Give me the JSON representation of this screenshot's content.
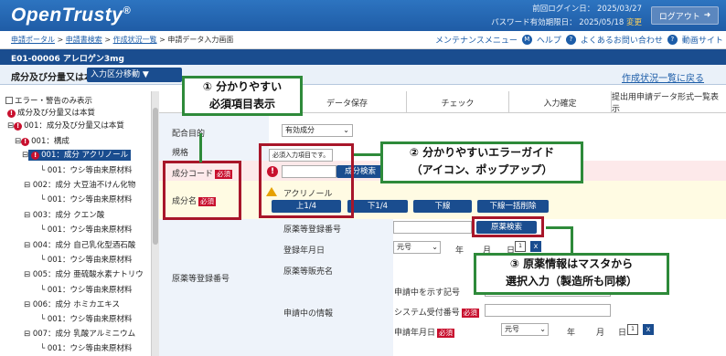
{
  "header": {
    "logo": "OpenTrusty",
    "logo_mark": "®",
    "last_login": "前回ログイン日：  2025/03/27",
    "pw_expiry": "パスワード有効期限日：  2025/05/18",
    "pw_change": "変更",
    "logout": "ログアウト"
  },
  "breadcrumb": {
    "items": [
      "申請ポータル",
      "申請書検索",
      "作成状況一覧",
      "申請データ入力画面"
    ],
    "sep": ">"
  },
  "toplinks": {
    "maintenance": "メンテナンスメニュー",
    "help": "ヘルプ",
    "faq": "よくあるお問い合わせ",
    "video": "動画サイト"
  },
  "idbar": {
    "text": "E01-00006  アレロゲン3mg"
  },
  "subbar": {
    "title": "成分及び分量又は本質",
    "move_btn": "入力区分移動 ▼",
    "back_link": "作成状況一覧に戻る"
  },
  "sidebar": {
    "filter": "エラー・警告のみ表示",
    "items": [
      {
        "label": "成分及び分量又は本質",
        "err": true
      },
      {
        "label": "001：成分及び分量又は本質",
        "err": true
      },
      {
        "label": "001：構成",
        "err": true
      },
      {
        "label": "001：成分 アクリノール",
        "err": true,
        "selected": true
      },
      {
        "label": "001：ウシ等由来原材料",
        "err": false
      },
      {
        "label": "002：成分 大豆油不けん化物",
        "err": false
      },
      {
        "label": "001：ウシ等由来原材料",
        "err": false
      },
      {
        "label": "003：成分 クエン酸",
        "err": false
      },
      {
        "label": "001：ウシ等由来原材料",
        "err": false
      },
      {
        "label": "004：成分 自己乳化型酒石酸",
        "err": false
      },
      {
        "label": "001：ウシ等由来原材料",
        "err": false
      },
      {
        "label": "005：成分 亜硫酸水素ナトリウ",
        "err": false
      },
      {
        "label": "001：ウシ等由来原材料",
        "err": false
      },
      {
        "label": "006：成分 ホミカエキス",
        "err": false
      },
      {
        "label": "001：ウシ等由来原材料",
        "err": false
      },
      {
        "label": "007：成分 乳酸アルミニウム",
        "err": false
      },
      {
        "label": "001：ウシ等由来原材料",
        "err": false
      }
    ]
  },
  "tabs": [
    "データ保存",
    "チェック",
    "入力確定",
    "提出用申請データ形式一覧表示"
  ],
  "form": {
    "blend_purpose_label": "配合目的",
    "blend_purpose_value": "有効成分",
    "standard_label": "規格",
    "component_code_label": "成分コード",
    "component_name_label": "成分名",
    "required": "必須",
    "tooltip": "必須入力項目です。",
    "search_btn": "成分検索",
    "component_name_value": "アクリノール",
    "btn_up14": "上1/4",
    "btn_down14": "下1/4",
    "btn_down": "下線",
    "btn_bulk": "下線一括削除",
    "drug_reg_label": "原薬等登録番号",
    "drug_reg_no_label": "原薬等登録番号",
    "drug_search_btn": "原薬検索",
    "reg_date_label": "登録年月日",
    "era": "元号",
    "year": "年",
    "month": "月",
    "day": "日",
    "seller_label": "原薬等販売名",
    "applying_label": "申請中の情報",
    "applying_sign_label": "申請中を示す記号",
    "sys_no_label": "システム受付番号",
    "app_date_label": "申請年月日",
    "x": "x"
  },
  "callouts": {
    "c1_line1": "① 分かりやすい",
    "c1_line2": "必須項目表示",
    "c2_line1": "② 分かりやすいエラーガイド",
    "c2_line2": "（アイコン、ポップアップ）",
    "c3_line1": "③ 原薬情報はマスタから",
    "c3_line2": "選択入力（製造所も同様）"
  },
  "colors": {
    "brand": "#1f5ca6",
    "error": "#c8102e",
    "callout": "#2e8a3a",
    "highlight": "#a8162a"
  }
}
